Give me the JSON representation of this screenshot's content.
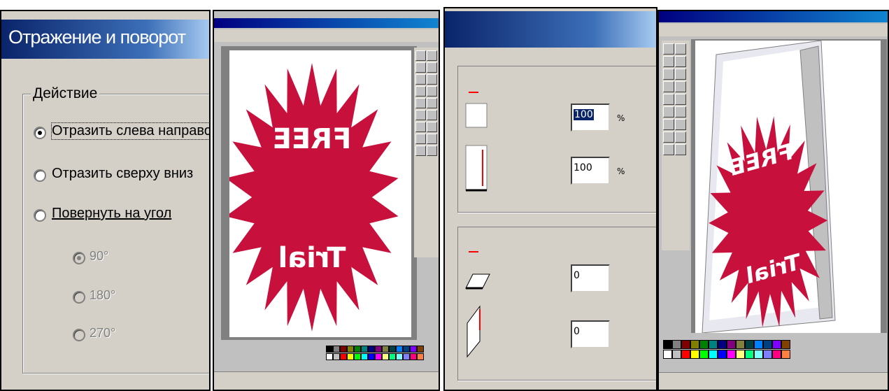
{
  "panel1": {
    "title": "Отражение и поворот",
    "group_label": "Действие",
    "options": [
      {
        "label": "Отразить слева направо",
        "selected": true
      },
      {
        "label": "Отразить сверху вниз",
        "selected": false
      },
      {
        "label": "Повернуть на угол",
        "selected": false
      }
    ],
    "angles": [
      {
        "label": "90°",
        "selected": true
      },
      {
        "label": "180°",
        "selected": false
      },
      {
        "label": "270°",
        "selected": false
      }
    ]
  },
  "panel2": {
    "artwork_top_text": "FREE",
    "artwork_bottom_text": "Trial",
    "starburst_color": "#c8103c"
  },
  "panel3": {
    "stretch_value": "100",
    "stretch_value_2": "100",
    "skew_value": "0",
    "skew_value_2": "0",
    "percent_unit": "%",
    "arrow_color": "#ff0000"
  },
  "panel4": {
    "artwork_top_text": "FREE",
    "artwork_bottom_text": "Trial",
    "starburst_color": "#c8103c"
  },
  "palette_colors": [
    "#000000",
    "#808080",
    "#800000",
    "#808000",
    "#008000",
    "#008080",
    "#000080",
    "#800080",
    "#808040",
    "#004040",
    "#0080ff",
    "#004080",
    "#8000ff",
    "#804000",
    "#ffffff",
    "#c0c0c0",
    "#ff0000",
    "#ffff00",
    "#00ff00",
    "#00ffff",
    "#0000ff",
    "#ff00ff",
    "#ffff80",
    "#00ff80",
    "#80ffff",
    "#8080ff",
    "#ff0080",
    "#ff8040"
  ]
}
